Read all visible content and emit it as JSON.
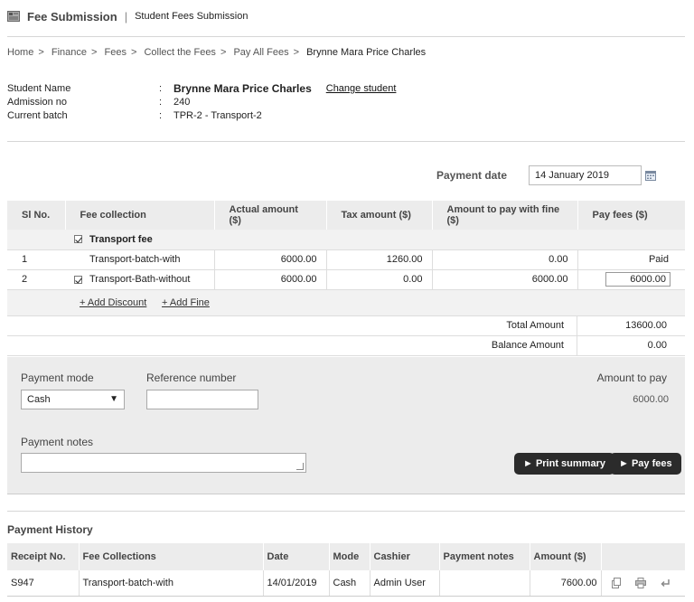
{
  "header": {
    "title": "Fee Submission",
    "separator": "|",
    "subtitle": "Student Fees Submission"
  },
  "breadcrumb": {
    "items": [
      "Home",
      "Finance",
      "Fees",
      "Collect the Fees",
      "Pay All Fees"
    ],
    "current": "Brynne Mara Price Charles",
    "arrow": ">"
  },
  "student": {
    "name_label": "Student Name",
    "name": "Brynne Mara Price Charles",
    "change_link": "Change student",
    "admission_label": "Admission no",
    "admission": "240",
    "batch_label": "Current batch",
    "batch": "TPR-2 - Transport-2",
    "colon": ":"
  },
  "payment_date": {
    "label": "Payment date",
    "value": "14 January 2019"
  },
  "fees_table": {
    "headers": [
      "Sl No.",
      "Fee collection",
      "Actual amount ($)",
      "Tax amount ($)",
      "Amount to pay with fine ($)",
      "Pay fees ($)"
    ],
    "group": "Transport fee",
    "rows": [
      {
        "sl": "1",
        "name": "Transport-batch-with",
        "actual": "6000.00",
        "tax": "1260.00",
        "to_pay": "0.00",
        "pay": "Paid"
      },
      {
        "sl": "2",
        "name": "Transport-Bath-without",
        "actual": "6000.00",
        "tax": "0.00",
        "to_pay": "6000.00",
        "pay": "6000.00"
      }
    ]
  },
  "links": {
    "add_discount": "+ Add Discount",
    "add_fine": "+ Add Fine"
  },
  "totals": {
    "total_label": "Total Amount",
    "total": "13600.00",
    "balance_label": "Balance Amount",
    "balance": "0.00"
  },
  "payment": {
    "mode_label": "Payment mode",
    "mode": "Cash",
    "select_arrow": "▼",
    "ref_label": "Reference number",
    "amount_label": "Amount to pay",
    "amount": "6000.00",
    "notes_label": "Payment notes",
    "print_btn": "► Print summary",
    "pay_btn": "► Pay fees"
  },
  "history": {
    "title": "Payment History",
    "headers": [
      "Receipt No.",
      "Fee Collections",
      "Date",
      "Mode",
      "Cashier",
      "Payment notes",
      "Amount ($)"
    ],
    "rows": [
      {
        "receipt": "S947",
        "fee": "Transport-batch-with",
        "date": "14/01/2019",
        "mode": "Cash",
        "cashier": "Admin User",
        "notes": "",
        "amount": "7600.00"
      }
    ]
  },
  "icons": [
    "fee-logo-icon",
    "calendar-icon",
    "receipt-view-icon",
    "print-icon",
    "revert-icon"
  ]
}
